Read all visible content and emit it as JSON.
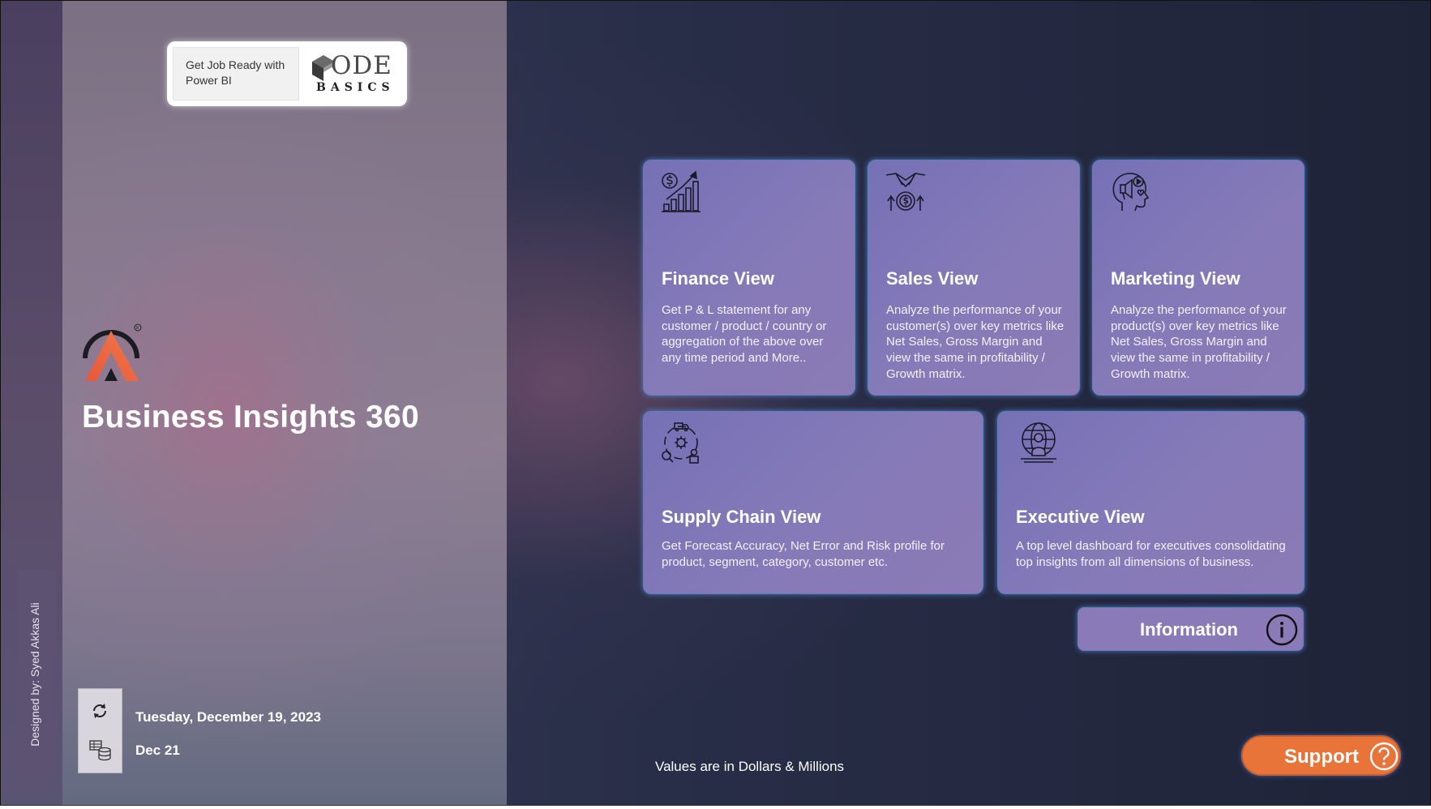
{
  "designer": {
    "text": "Designed by: Syed Akkas Ali"
  },
  "promo": {
    "text_line1": "Get Job Ready with",
    "text_line2": "Power BI",
    "logo_line1": "ODE",
    "logo_line2": "BASICS"
  },
  "app": {
    "title": "Business Insights 360"
  },
  "refresh": {
    "date_long": "Tuesday, December 19, 2023",
    "date_short": "Dec 21"
  },
  "tiles": [
    {
      "title": "Finance View",
      "desc": "Get P & L statement for any customer / product / country or aggregation of the above over any time period and More..",
      "icon": "finance-chart-icon"
    },
    {
      "title": "Sales View",
      "desc": "Analyze the performance of your customer(s) over key metrics like Net Sales, Gross Margin and view the same in profitability / Growth matrix.",
      "icon": "handshake-dollar-icon"
    },
    {
      "title": "Marketing View",
      "desc": "Analyze the performance of your product(s) over key metrics like Net Sales, Gross Margin and view the same in profitability / Growth matrix.",
      "icon": "marketing-head-icon"
    },
    {
      "title": "Supply Chain View",
      "desc": "Get Forecast Accuracy, Net Error and Risk profile for product, segment, category, customer etc.",
      "icon": "supply-chain-icon"
    },
    {
      "title": "Executive View",
      "desc": "A top level dashboard for executives consolidating top insights from all dimensions of business.",
      "icon": "executive-globe-icon"
    }
  ],
  "info": {
    "label": "Information"
  },
  "footer": {
    "values_note": "Values are in Dollars & Millions"
  },
  "support": {
    "label": "Support"
  },
  "colors": {
    "tile": "#857ab8",
    "tile_border": "#5e7fc0",
    "support": "#e8743a",
    "background": "#1f2338"
  }
}
